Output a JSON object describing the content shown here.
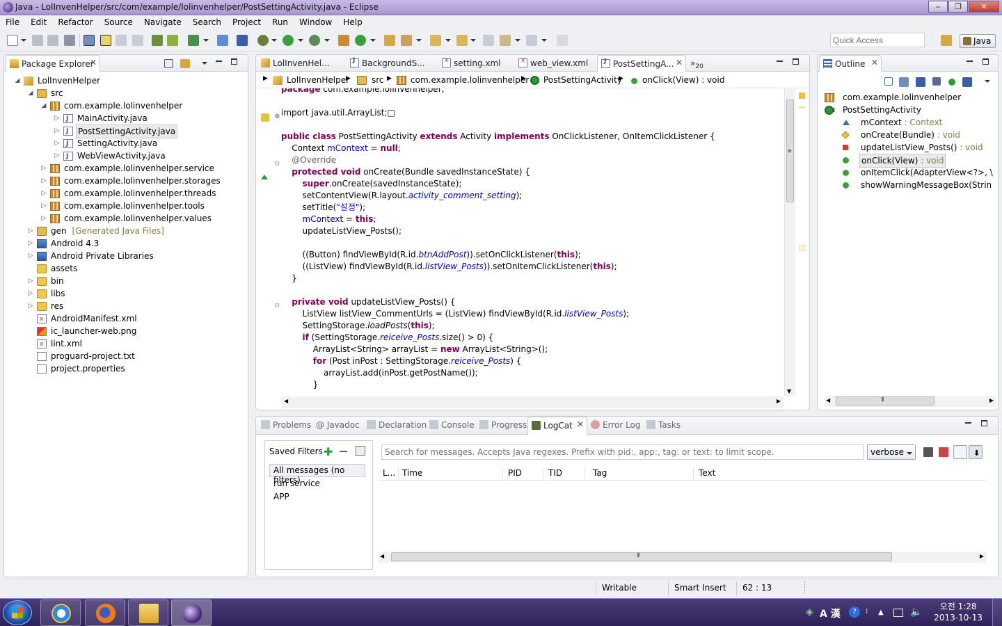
{
  "window": {
    "title": "Java - LolInvenHelper/src/com/example/lolinvenhelper/PostSettingActivity.java - Eclipse",
    "controls": [
      "‒",
      "❐",
      "✕"
    ]
  },
  "menu": [
    "File",
    "Edit",
    "Refactor",
    "Source",
    "Navigate",
    "Search",
    "Project",
    "Run",
    "Window",
    "Help"
  ],
  "toolbar": {
    "quick_access_placeholder": "Quick Access",
    "perspective": "Java"
  },
  "package_explorer": {
    "title": "Package Explorer",
    "tree": [
      {
        "label": "LolInvenHelper",
        "icon": "project-icon",
        "twisty": "expanded"
      },
      {
        "label": "src",
        "icon": "source-folder-icon",
        "twisty": "expanded"
      },
      {
        "label": "com.example.lolinvenhelper",
        "icon": "package-icon",
        "twisty": "expanded"
      },
      {
        "label": "MainActivity.java",
        "icon": "java-file-icon",
        "twisty": "collapsed"
      },
      {
        "label": "PostSettingActivity.java",
        "icon": "java-file-icon",
        "twisty": "collapsed",
        "selected": true
      },
      {
        "label": "SettingActivity.java",
        "icon": "java-file-icon",
        "twisty": "collapsed"
      },
      {
        "label": "WebViewActivity.java",
        "icon": "java-file-icon",
        "twisty": "collapsed"
      },
      {
        "label": "com.example.lolinvenhelper.service",
        "icon": "package-icon",
        "twisty": "collapsed"
      },
      {
        "label": "com.example.lolinvenhelper.storages",
        "icon": "package-icon",
        "twisty": "collapsed"
      },
      {
        "label": "com.example.lolinvenhelper.threads",
        "icon": "package-icon",
        "twisty": "collapsed"
      },
      {
        "label": "com.example.lolinvenhelper.tools",
        "icon": "package-icon",
        "twisty": "collapsed"
      },
      {
        "label": "com.example.lolinvenhelper.values",
        "icon": "package-icon",
        "twisty": "collapsed"
      },
      {
        "label": "gen",
        "suffix": "[Generated Java Files]",
        "icon": "source-folder-icon",
        "twisty": "collapsed"
      },
      {
        "label": "Android 4.3",
        "icon": "library-icon",
        "twisty": "collapsed"
      },
      {
        "label": "Android Private Libraries",
        "icon": "library-icon",
        "twisty": "collapsed"
      },
      {
        "label": "assets",
        "icon": "folder-icon",
        "twisty": "none"
      },
      {
        "label": "bin",
        "icon": "folder-icon",
        "twisty": "collapsed"
      },
      {
        "label": "libs",
        "icon": "folder-icon",
        "twisty": "collapsed"
      },
      {
        "label": "res",
        "icon": "folder-icon",
        "twisty": "collapsed"
      },
      {
        "label": "AndroidManifest.xml",
        "icon": "xml-file-icon",
        "twisty": "none"
      },
      {
        "label": "ic_launcher-web.png",
        "icon": "image-file-icon",
        "twisty": "none"
      },
      {
        "label": "lint.xml",
        "icon": "xml-file-icon",
        "twisty": "none"
      },
      {
        "label": "proguard-project.txt",
        "icon": "text-file-icon",
        "twisty": "none"
      },
      {
        "label": "project.properties",
        "icon": "text-file-icon",
        "twisty": "none"
      }
    ]
  },
  "editor": {
    "tabs": [
      {
        "label": "LolInvenHel...",
        "icon": "project-icon"
      },
      {
        "label": "BackgroundS...",
        "icon": "java-file-icon"
      },
      {
        "label": "setting.xml",
        "icon": "xml-file-icon"
      },
      {
        "label": "web_view.xml",
        "icon": "xml-file-icon"
      },
      {
        "label": "PostSettingA...",
        "icon": "java-file-icon",
        "active": true
      }
    ],
    "overflow": "»",
    "overflow_count": "20",
    "breadcrumb": [
      "LolInvenHelper",
      "src",
      "com.example.lolinvenhelper",
      "PostSettingActivity",
      "onClick(View) : void"
    ],
    "lines": [
      [
        [
          "kw",
          "package"
        ],
        [
          "t",
          " com.example.lolinvenhelper;"
        ]
      ],
      [],
      [
        [
          "t",
          "import java.util.ArrayList;"
        ],
        [
          "t",
          "□"
        ]
      ],
      [],
      [
        [
          "kw",
          "public class"
        ],
        [
          "t",
          " PostSettingActivity "
        ],
        [
          "kw",
          "extends"
        ],
        [
          "t",
          " Activity "
        ],
        [
          "kw",
          "implements"
        ],
        [
          "t",
          " OnClickListener, OnItemClickListener {"
        ]
      ],
      [
        [
          "t",
          "    Context "
        ],
        [
          "fld",
          "mContext"
        ],
        [
          "t",
          " = "
        ],
        [
          "kw",
          "null"
        ],
        [
          "t",
          ";"
        ]
      ],
      [
        [
          "ann",
          "    @Override"
        ]
      ],
      [
        [
          "t",
          "    "
        ],
        [
          "kw",
          "protected void"
        ],
        [
          "t",
          " onCreate(Bundle savedInstanceState) {"
        ]
      ],
      [
        [
          "t",
          "        "
        ],
        [
          "kw",
          "super"
        ],
        [
          "t",
          ".onCreate(savedInstanceState);"
        ]
      ],
      [
        [
          "t",
          "        setContentView(R.layout."
        ],
        [
          "sfi",
          "activity_comment_setting"
        ],
        [
          "t",
          ");"
        ]
      ],
      [
        [
          "t",
          "        setTitle("
        ],
        [
          "str",
          "\"설정\""
        ],
        [
          "t",
          ");"
        ]
      ],
      [
        [
          "t",
          "        "
        ],
        [
          "fld",
          "mContext"
        ],
        [
          "t",
          " = "
        ],
        [
          "kw",
          "this"
        ],
        [
          "t",
          ";"
        ]
      ],
      [
        [
          "t",
          "        updateListView_Posts();"
        ]
      ],
      [],
      [
        [
          "t",
          "        ((Button) findViewById(R.id."
        ],
        [
          "sfi",
          "btnAddPost"
        ],
        [
          "t",
          ")).setOnClickListener("
        ],
        [
          "kw",
          "this"
        ],
        [
          "t",
          ");"
        ]
      ],
      [
        [
          "t",
          "        ((ListView) findViewById(R.id."
        ],
        [
          "sfi",
          "listView_Posts"
        ],
        [
          "t",
          ")).setOnItemClickListener("
        ],
        [
          "kw",
          "this"
        ],
        [
          "t",
          ");"
        ]
      ],
      [
        [
          "t",
          "    }"
        ]
      ],
      [],
      [
        [
          "t",
          "    "
        ],
        [
          "kw",
          "private void"
        ],
        [
          "t",
          " updateListView_Posts() {"
        ]
      ],
      [
        [
          "t",
          "        ListView listView_CommentUrls = (ListView) findViewById(R.id."
        ],
        [
          "sfi",
          "listView_Posts"
        ],
        [
          "t",
          ");"
        ]
      ],
      [
        [
          "t",
          "        SettingStorage."
        ],
        [
          "sm",
          "loadPosts"
        ],
        [
          "t",
          "("
        ],
        [
          "kw",
          "this"
        ],
        [
          "t",
          ");"
        ]
      ],
      [
        [
          "t",
          "        "
        ],
        [
          "kw",
          "if"
        ],
        [
          "t",
          " (SettingStorage."
        ],
        [
          "sfi",
          "reiceive_Posts"
        ],
        [
          "t",
          ".size() > 0) {"
        ]
      ],
      [
        [
          "t",
          "            ArrayList<String> arrayList = "
        ],
        [
          "kw",
          "new"
        ],
        [
          "t",
          " ArrayList<String>();"
        ]
      ],
      [
        [
          "t",
          "            "
        ],
        [
          "kw",
          "for"
        ],
        [
          "t",
          " (Post inPost : SettingStorage."
        ],
        [
          "sfi",
          "reiceive_Posts"
        ],
        [
          "t",
          ") {"
        ]
      ],
      [
        [
          "t",
          "                arrayList.add(inPost.getPostName());"
        ]
      ],
      [
        [
          "t",
          "            }"
        ]
      ]
    ]
  },
  "outline": {
    "title": "Outline",
    "items": [
      {
        "name": "com.example.lolinvenhelper",
        "type": "",
        "icon": "package-icon",
        "indent": 0
      },
      {
        "name": "PostSettingActivity",
        "type": "",
        "icon": "class-icon",
        "indent": 0,
        "twisty": "expanded"
      },
      {
        "name": "mContext",
        "type": " : Context",
        "icon": "field-default-icon",
        "indent": 1
      },
      {
        "name": "onCreate(Bundle)",
        "type": " : void",
        "icon": "method-protected-icon",
        "indent": 1
      },
      {
        "name": "updateListView_Posts()",
        "type": " : void",
        "icon": "method-private-icon",
        "indent": 1
      },
      {
        "name": "onClick(View)",
        "type": " : void",
        "icon": "method-public-icon",
        "indent": 1,
        "selected": true
      },
      {
        "name": "onItemClick(AdapterView<?>, \\",
        "type": "",
        "icon": "method-public-icon",
        "indent": 1
      },
      {
        "name": "showWarningMessageBox(Strin",
        "type": "",
        "icon": "method-public-icon",
        "indent": 1
      }
    ]
  },
  "bottom": {
    "tabs": [
      {
        "label": "Problems",
        "icon": "problems-icon"
      },
      {
        "label": "@ Javadoc",
        "icon": ""
      },
      {
        "label": "Declaration",
        "icon": "declaration-icon"
      },
      {
        "label": "Console",
        "icon": "console-icon"
      },
      {
        "label": "Progress",
        "icon": "progress-icon"
      },
      {
        "label": "LogCat",
        "icon": "logcat-icon",
        "active": true
      },
      {
        "label": "Error Log",
        "icon": "error-log-icon"
      },
      {
        "label": "Tasks",
        "icon": "tasks-icon"
      }
    ],
    "saved_filters_title": "Saved Filters",
    "filters": [
      "All messages (no filters)",
      "run service",
      "APP"
    ],
    "search_placeholder": "Search for messages. Accepts Java regexes. Prefix with pid:, app:, tag: or text: to limit scope.",
    "level": "verbose",
    "columns": [
      "L...",
      "Time",
      "PID",
      "TID",
      "Tag",
      "Text"
    ]
  },
  "status": {
    "writable": "Writable",
    "insert_mode": "Smart Insert",
    "position": "62 : 13"
  },
  "taskbar": {
    "ime_mode": "A 漢",
    "time": "오전 1:28",
    "date": "2013-10-13"
  },
  "colors": {
    "keyword": "#7f0055",
    "field": "#0000c0",
    "string": "#2a00ff",
    "annotation": "#646464"
  }
}
